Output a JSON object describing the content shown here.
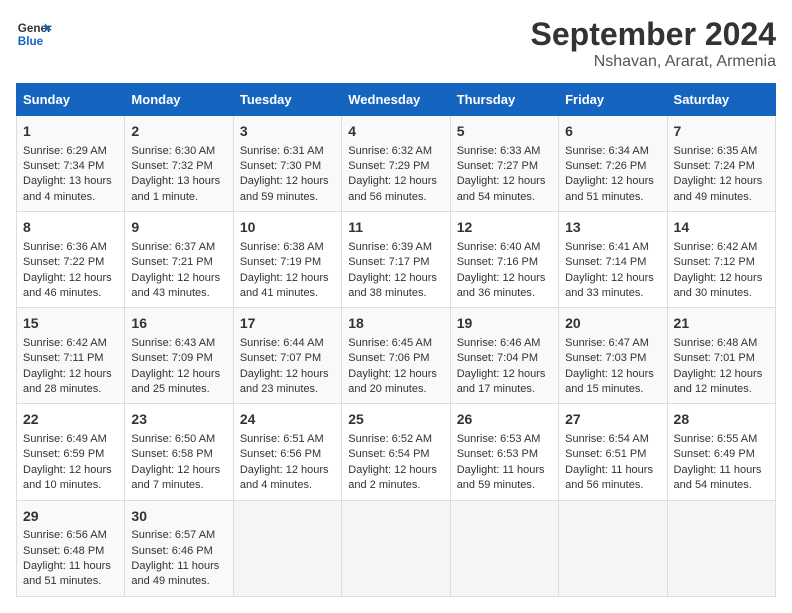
{
  "header": {
    "logo_general": "General",
    "logo_blue": "Blue",
    "title": "September 2024",
    "subtitle": "Nshavan, Ararat, Armenia"
  },
  "days_of_week": [
    "Sunday",
    "Monday",
    "Tuesday",
    "Wednesday",
    "Thursday",
    "Friday",
    "Saturday"
  ],
  "weeks": [
    [
      {
        "day": "1",
        "sunrise": "Sunrise: 6:29 AM",
        "sunset": "Sunset: 7:34 PM",
        "daylight": "Daylight: 13 hours and 4 minutes."
      },
      {
        "day": "2",
        "sunrise": "Sunrise: 6:30 AM",
        "sunset": "Sunset: 7:32 PM",
        "daylight": "Daylight: 13 hours and 1 minute."
      },
      {
        "day": "3",
        "sunrise": "Sunrise: 6:31 AM",
        "sunset": "Sunset: 7:30 PM",
        "daylight": "Daylight: 12 hours and 59 minutes."
      },
      {
        "day": "4",
        "sunrise": "Sunrise: 6:32 AM",
        "sunset": "Sunset: 7:29 PM",
        "daylight": "Daylight: 12 hours and 56 minutes."
      },
      {
        "day": "5",
        "sunrise": "Sunrise: 6:33 AM",
        "sunset": "Sunset: 7:27 PM",
        "daylight": "Daylight: 12 hours and 54 minutes."
      },
      {
        "day": "6",
        "sunrise": "Sunrise: 6:34 AM",
        "sunset": "Sunset: 7:26 PM",
        "daylight": "Daylight: 12 hours and 51 minutes."
      },
      {
        "day": "7",
        "sunrise": "Sunrise: 6:35 AM",
        "sunset": "Sunset: 7:24 PM",
        "daylight": "Daylight: 12 hours and 49 minutes."
      }
    ],
    [
      {
        "day": "8",
        "sunrise": "Sunrise: 6:36 AM",
        "sunset": "Sunset: 7:22 PM",
        "daylight": "Daylight: 12 hours and 46 minutes."
      },
      {
        "day": "9",
        "sunrise": "Sunrise: 6:37 AM",
        "sunset": "Sunset: 7:21 PM",
        "daylight": "Daylight: 12 hours and 43 minutes."
      },
      {
        "day": "10",
        "sunrise": "Sunrise: 6:38 AM",
        "sunset": "Sunset: 7:19 PM",
        "daylight": "Daylight: 12 hours and 41 minutes."
      },
      {
        "day": "11",
        "sunrise": "Sunrise: 6:39 AM",
        "sunset": "Sunset: 7:17 PM",
        "daylight": "Daylight: 12 hours and 38 minutes."
      },
      {
        "day": "12",
        "sunrise": "Sunrise: 6:40 AM",
        "sunset": "Sunset: 7:16 PM",
        "daylight": "Daylight: 12 hours and 36 minutes."
      },
      {
        "day": "13",
        "sunrise": "Sunrise: 6:41 AM",
        "sunset": "Sunset: 7:14 PM",
        "daylight": "Daylight: 12 hours and 33 minutes."
      },
      {
        "day": "14",
        "sunrise": "Sunrise: 6:42 AM",
        "sunset": "Sunset: 7:12 PM",
        "daylight": "Daylight: 12 hours and 30 minutes."
      }
    ],
    [
      {
        "day": "15",
        "sunrise": "Sunrise: 6:42 AM",
        "sunset": "Sunset: 7:11 PM",
        "daylight": "Daylight: 12 hours and 28 minutes."
      },
      {
        "day": "16",
        "sunrise": "Sunrise: 6:43 AM",
        "sunset": "Sunset: 7:09 PM",
        "daylight": "Daylight: 12 hours and 25 minutes."
      },
      {
        "day": "17",
        "sunrise": "Sunrise: 6:44 AM",
        "sunset": "Sunset: 7:07 PM",
        "daylight": "Daylight: 12 hours and 23 minutes."
      },
      {
        "day": "18",
        "sunrise": "Sunrise: 6:45 AM",
        "sunset": "Sunset: 7:06 PM",
        "daylight": "Daylight: 12 hours and 20 minutes."
      },
      {
        "day": "19",
        "sunrise": "Sunrise: 6:46 AM",
        "sunset": "Sunset: 7:04 PM",
        "daylight": "Daylight: 12 hours and 17 minutes."
      },
      {
        "day": "20",
        "sunrise": "Sunrise: 6:47 AM",
        "sunset": "Sunset: 7:03 PM",
        "daylight": "Daylight: 12 hours and 15 minutes."
      },
      {
        "day": "21",
        "sunrise": "Sunrise: 6:48 AM",
        "sunset": "Sunset: 7:01 PM",
        "daylight": "Daylight: 12 hours and 12 minutes."
      }
    ],
    [
      {
        "day": "22",
        "sunrise": "Sunrise: 6:49 AM",
        "sunset": "Sunset: 6:59 PM",
        "daylight": "Daylight: 12 hours and 10 minutes."
      },
      {
        "day": "23",
        "sunrise": "Sunrise: 6:50 AM",
        "sunset": "Sunset: 6:58 PM",
        "daylight": "Daylight: 12 hours and 7 minutes."
      },
      {
        "day": "24",
        "sunrise": "Sunrise: 6:51 AM",
        "sunset": "Sunset: 6:56 PM",
        "daylight": "Daylight: 12 hours and 4 minutes."
      },
      {
        "day": "25",
        "sunrise": "Sunrise: 6:52 AM",
        "sunset": "Sunset: 6:54 PM",
        "daylight": "Daylight: 12 hours and 2 minutes."
      },
      {
        "day": "26",
        "sunrise": "Sunrise: 6:53 AM",
        "sunset": "Sunset: 6:53 PM",
        "daylight": "Daylight: 11 hours and 59 minutes."
      },
      {
        "day": "27",
        "sunrise": "Sunrise: 6:54 AM",
        "sunset": "Sunset: 6:51 PM",
        "daylight": "Daylight: 11 hours and 56 minutes."
      },
      {
        "day": "28",
        "sunrise": "Sunrise: 6:55 AM",
        "sunset": "Sunset: 6:49 PM",
        "daylight": "Daylight: 11 hours and 54 minutes."
      }
    ],
    [
      {
        "day": "29",
        "sunrise": "Sunrise: 6:56 AM",
        "sunset": "Sunset: 6:48 PM",
        "daylight": "Daylight: 11 hours and 51 minutes."
      },
      {
        "day": "30",
        "sunrise": "Sunrise: 6:57 AM",
        "sunset": "Sunset: 6:46 PM",
        "daylight": "Daylight: 11 hours and 49 minutes."
      },
      null,
      null,
      null,
      null,
      null
    ]
  ]
}
